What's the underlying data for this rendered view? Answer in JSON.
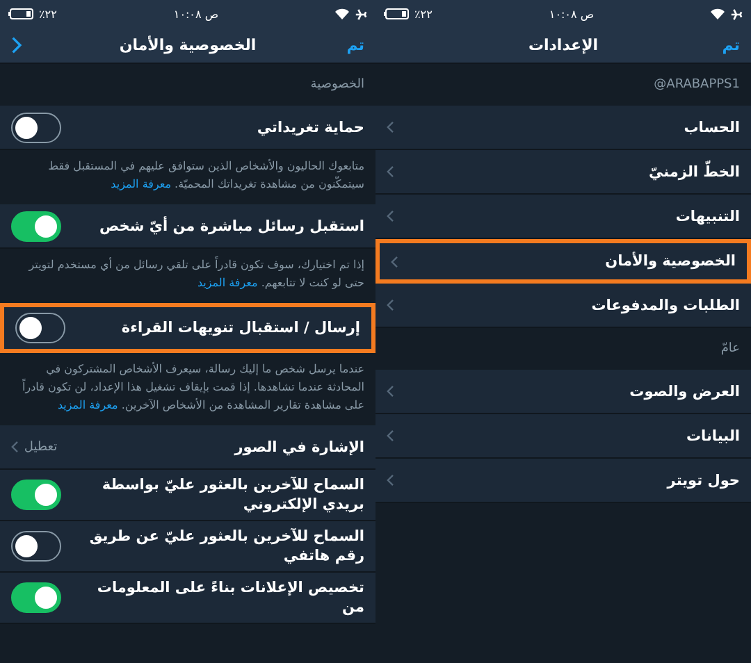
{
  "screens": [
    {
      "status_bar": {
        "battery": "٪٢٢",
        "time": "١٠:٠٨ ص"
      },
      "nav": {
        "title": "الإعدادات",
        "done": "تم",
        "back": false
      },
      "items": [
        {
          "kind": "section",
          "label": "@ARABAPPS1"
        },
        {
          "kind": "link",
          "label": "الحساب",
          "highlighted": false
        },
        {
          "kind": "link",
          "label": "الخطّ الزمنيّ",
          "highlighted": false
        },
        {
          "kind": "link",
          "label": "التنبيهات",
          "highlighted": false
        },
        {
          "kind": "link",
          "label": "الخصوصية والأمان",
          "highlighted": true
        },
        {
          "kind": "link",
          "label": "الطلبات والمدفوعات",
          "highlighted": false
        },
        {
          "kind": "section",
          "label": "عامّ"
        },
        {
          "kind": "link",
          "label": "العرض والصوت",
          "highlighted": false
        },
        {
          "kind": "link",
          "label": "البيانات",
          "highlighted": false
        },
        {
          "kind": "link",
          "label": "حول تويتر",
          "highlighted": false
        }
      ]
    },
    {
      "status_bar": {
        "battery": "٪٢٢",
        "time": "١٠:٠٨ ص"
      },
      "nav": {
        "title": "الخصوصية والأمان",
        "done": "تم",
        "back": true
      },
      "items": [
        {
          "kind": "section",
          "label": "الخصوصية"
        },
        {
          "kind": "toggle",
          "label": "حماية تغريداتي",
          "on": false,
          "highlighted": false
        },
        {
          "kind": "description",
          "text": "متابعوك الحاليون والأشخاص الذين ستوافق عليهم في المستقبل فقط سيتمكّنون من مشاهدة تغريداتك المحميّة.",
          "link": "معرفة المزيد"
        },
        {
          "kind": "toggle",
          "label": "استقبل رسائل مباشرة من أيّ شخص",
          "on": true,
          "highlighted": false
        },
        {
          "kind": "description",
          "text": "إذا تم اختيارك، سوف تكون قادراً على تلقي رسائل من أي مستخدم لتويتر حتى لو كنت لا تتابعهم.",
          "link": "معرفة المزيد"
        },
        {
          "kind": "toggle",
          "label": "إرسال / استقبال تنويهات القراءة",
          "on": false,
          "highlighted": true
        },
        {
          "kind": "description",
          "text": "عندما يرسل شخص ما إليك رسالة، سيعرف الأشخاص المشتركون في المحادثة عندما تشاهدها. إذا قمت بإيقاف تشغيل هذا الإعداد، لن تكون قادراً على مشاهدة تقارير المشاهدة من الأشخاص الآخرين.",
          "link": "معرفة المزيد"
        },
        {
          "kind": "link",
          "label": "الإشارة في الصور",
          "value": "تعطيل",
          "highlighted": false
        },
        {
          "kind": "toggle",
          "label": "السماح للآخرين بالعثور عليّ بواسطة بريدي الإلكتروني",
          "on": true,
          "highlighted": false
        },
        {
          "kind": "toggle",
          "label": "السماح للآخرين بالعثور عليّ عن طريق رقم هاتفي",
          "on": false,
          "highlighted": false
        },
        {
          "kind": "toggle",
          "label": "تخصيص الإعلانات بناءً على المعلومات من",
          "on": true,
          "highlighted": false
        }
      ]
    }
  ]
}
